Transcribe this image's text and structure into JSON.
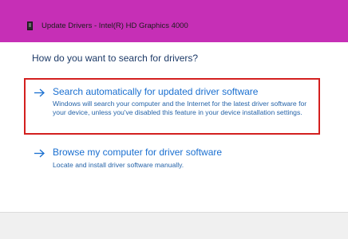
{
  "window": {
    "title": "Update Drivers - Intel(R) HD Graphics 4000",
    "titlebar_color": "#c62fb6",
    "icon": "device-icon"
  },
  "main": {
    "question": "How do you want to search for drivers?",
    "options": [
      {
        "heading": "Search automatically for updated driver software",
        "description": "Windows will search your computer and the Internet for the latest driver software for your device, unless you've disabled this feature in your device installation settings.",
        "icon": "arrow-right-icon",
        "highlighted": true
      },
      {
        "heading": "Browse my computer for driver software",
        "description": "Locate and install driver software manually.",
        "icon": "arrow-right-icon",
        "highlighted": false
      }
    ]
  },
  "colors": {
    "link": "#1a6fd0",
    "question": "#1e3b68",
    "highlight_border": "#d3201f"
  }
}
